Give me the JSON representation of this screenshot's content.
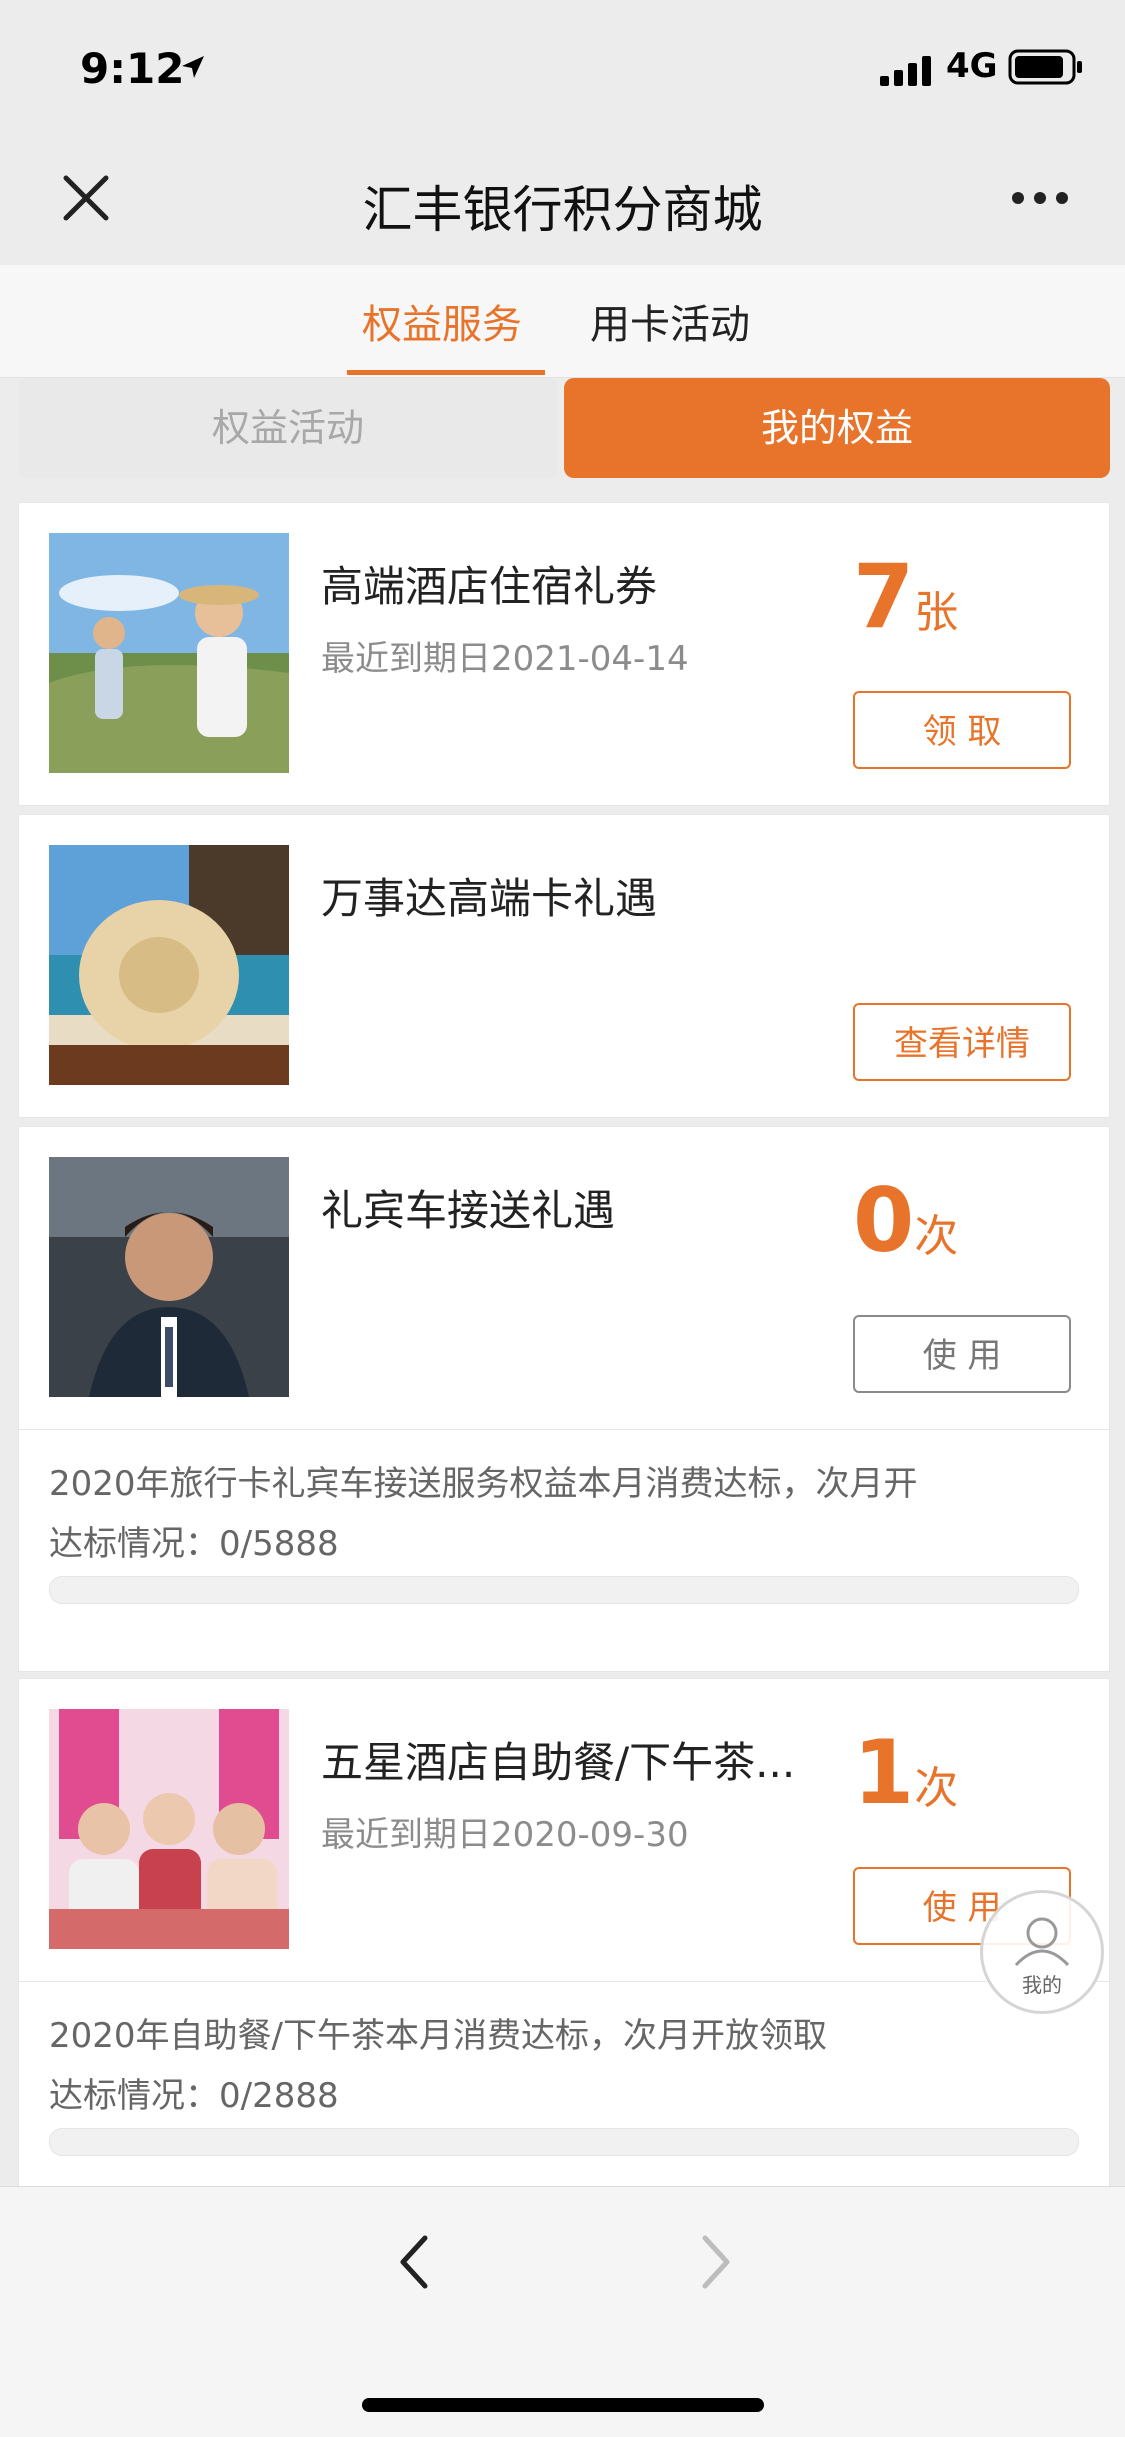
{
  "status_bar": {
    "time": "9:12",
    "network": "4G"
  },
  "nav": {
    "title": "汇丰银行积分商城"
  },
  "tabs": [
    {
      "label": "权益服务",
      "active": true
    },
    {
      "label": "用卡活动",
      "active": false
    }
  ],
  "segments": [
    {
      "label": "权益活动",
      "active": false
    },
    {
      "label": "我的权益",
      "active": true
    }
  ],
  "cards": [
    {
      "title": "高端酒店住宿礼券",
      "subtitle": "最近到期日2021-04-14",
      "count": "7",
      "unit": "张",
      "button": "领  取"
    },
    {
      "title": "万事达高端卡礼遇",
      "button": "查看详情"
    },
    {
      "title": "礼宾车接送礼遇",
      "count": "0",
      "unit": "次",
      "button": "使    用",
      "progress_desc": "2020年旅行卡礼宾车接送服务权益本月消费达标，次月开",
      "progress_status": "达标情况：0/5888",
      "progress_fraction": 0
    },
    {
      "title": "五星酒店自助餐/下午茶...",
      "subtitle": "最近到期日2020-09-30",
      "count": "1",
      "unit": "次",
      "button": "使    用",
      "progress_desc": "2020年自助餐/下午茶本月消费达标，次月开放领取",
      "progress_status": "达标情况：0/2888",
      "progress_fraction": 0
    }
  ],
  "floating": {
    "label": "我的"
  },
  "colors": {
    "accent": "#e8732b",
    "background": "#ececec"
  },
  "icons": [
    "close-icon",
    "more-icon",
    "back-icon",
    "forward-icon",
    "user-icon",
    "location-arrow-icon",
    "signal-icon",
    "battery-icon"
  ]
}
